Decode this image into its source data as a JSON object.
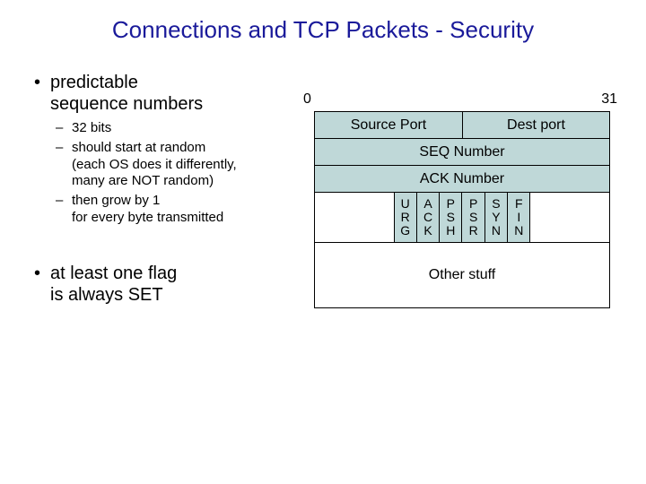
{
  "title": "Connections and TCP Packets - Security",
  "bullets": {
    "b1a": "predictable\nsequence numbers",
    "sub1": "32 bits",
    "sub2": "should start at random\n(each OS does it differently,\nmany are NOT random)",
    "sub3": "then grow by 1\nfor every byte transmitted",
    "b1b": "at least one flag\nis always SET"
  },
  "diagram": {
    "bit_low": "0",
    "bit_high": "31",
    "source_port": "Source Port",
    "dest_port": "Dest port",
    "seq": "SEQ Number",
    "ack": "ACK Number",
    "flags": [
      "U\nR\nG",
      "A\nC\nK",
      "P\nS\nH",
      "P\nS\nR",
      "S\nY\nN",
      "F\nI\nN"
    ],
    "other": "Other stuff"
  },
  "glyphs": {
    "dot": "•",
    "dash": "–"
  }
}
